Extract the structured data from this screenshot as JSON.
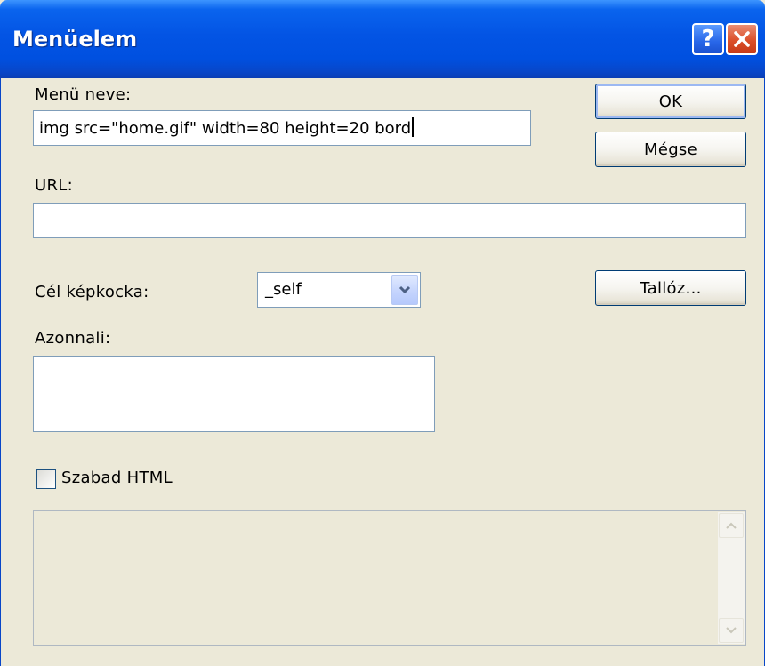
{
  "window": {
    "title": "Menüelem",
    "help_icon": "question-mark-icon",
    "close_icon": "close-x-icon"
  },
  "form": {
    "menu_name_label": "Menü neve:",
    "menu_name_value": "img src=\"home.gif\" width=80 height=20 bord",
    "url_label": "URL:",
    "url_value": "",
    "target_frame_label": "Cél képkocka:",
    "target_frame_selected": "_self",
    "immediate_label": "Azonnali:",
    "immediate_value": "",
    "free_html_label": "Szabad HTML",
    "free_html_checked": false
  },
  "buttons": {
    "ok": "OK",
    "cancel": "Mégse",
    "browse": "Tallóz..."
  },
  "colors": {
    "titlebar": "#0054E3",
    "dialog_background": "#ECE9D8",
    "close_button": "#DC4F2A",
    "input_border": "#7F9DB9"
  }
}
